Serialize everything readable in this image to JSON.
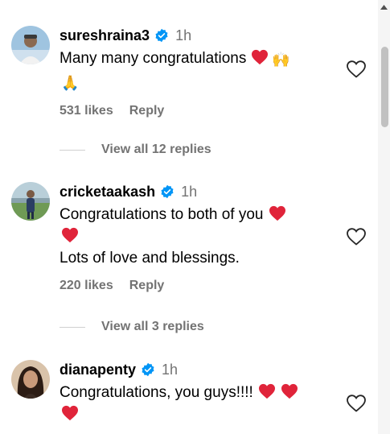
{
  "comments": [
    {
      "username": "sureshraina3",
      "time": "1h",
      "line1": "Many many congratulations",
      "emoji1": "🙌",
      "emoji2": "🙏",
      "likes": "531 likes",
      "reply": "Reply",
      "view_replies": "View all 12 replies"
    },
    {
      "username": "cricketaakash",
      "time": "1h",
      "line1": "Congratulations to both of you",
      "line2": "Lots of love and blessings.",
      "likes": "220 likes",
      "reply": "Reply",
      "view_replies": "View all 3 replies"
    },
    {
      "username": "dianapenty",
      "time": "1h",
      "line1": "Congratulations, you guys!!!!"
    }
  ],
  "icons": {
    "verified": "verified-badge-icon",
    "heart_emoji": "red-heart",
    "like": "heart-outline-icon"
  },
  "colors": {
    "verified": "#0095f6",
    "heart": "#e0243a",
    "secondary_text": "#737373"
  }
}
